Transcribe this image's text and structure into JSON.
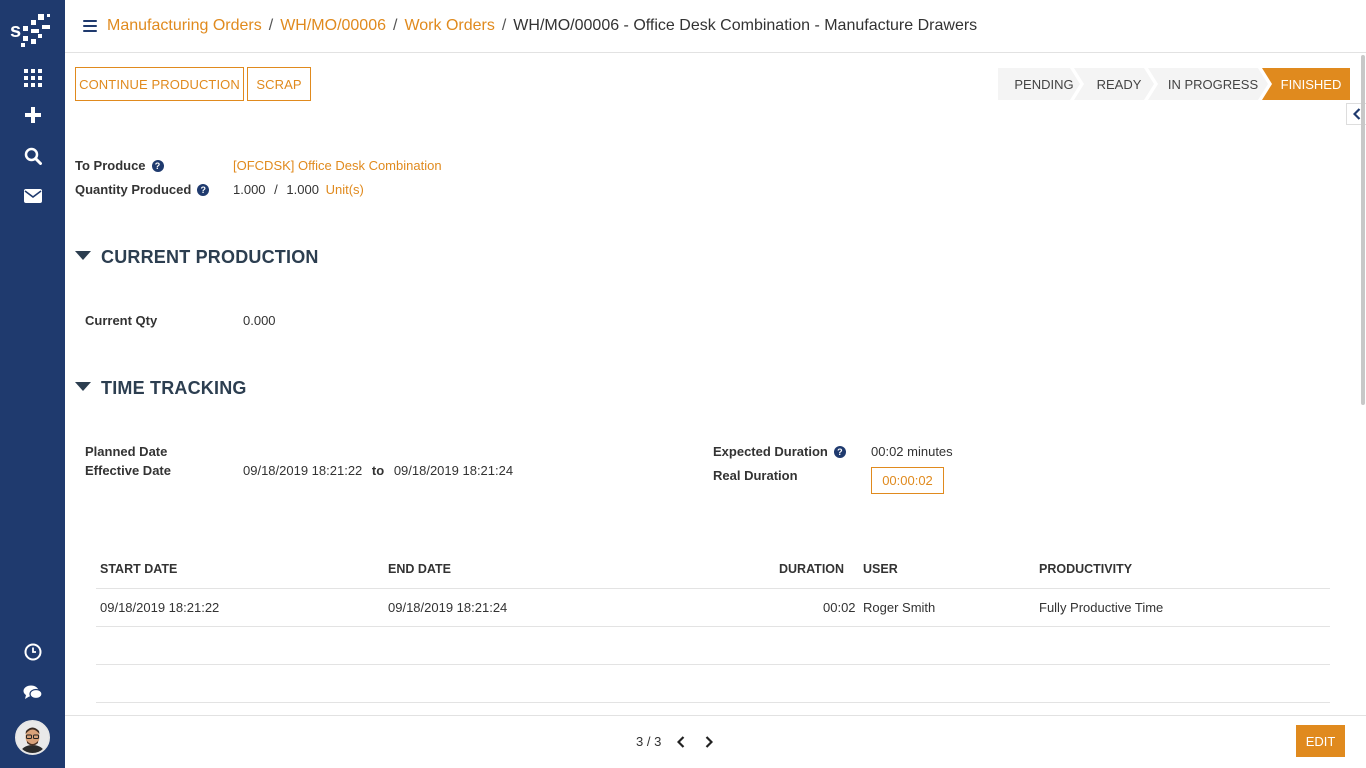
{
  "sidebar": {
    "icons": [
      "apps-grid-icon",
      "plus-icon",
      "search-icon",
      "mail-icon",
      "clock-icon",
      "chat-icon"
    ],
    "brand_color": "#1f3a6e"
  },
  "breadcrumb": {
    "items": [
      "Manufacturing Orders",
      "WH/MO/00006",
      "Work Orders"
    ],
    "current": "WH/MO/00006 - Office Desk Combination - Manufacture Drawers",
    "separator": "/"
  },
  "actions": {
    "continue_label": "CONTINUE PRODUCTION",
    "scrap_label": "SCRAP"
  },
  "status": {
    "stages": [
      "PENDING",
      "READY",
      "IN PROGRESS",
      "FINISHED"
    ],
    "active": "FINISHED",
    "accent_color": "#e08a1e"
  },
  "form": {
    "to_produce_label": "To Produce",
    "to_produce_value": "[OFCDSK] Office Desk Combination",
    "qty_produced_label": "Quantity Produced",
    "qty_produced": "1.000",
    "qty_sep": "/",
    "qty_total": "1.000",
    "uom": "Unit(s)"
  },
  "current_production": {
    "title": "CURRENT PRODUCTION",
    "current_qty_label": "Current Qty",
    "current_qty_value": "0.000"
  },
  "time_tracking": {
    "title": "TIME TRACKING",
    "planned_date_label": "Planned Date",
    "effective_date_label": "Effective Date",
    "effective_from": "09/18/2019 18:21:22",
    "to_word": "to",
    "effective_to": "09/18/2019 18:21:24",
    "expected_duration_label": "Expected Duration",
    "expected_duration_value": "00:02 minutes",
    "real_duration_label": "Real Duration",
    "real_duration_value": "00:00:02"
  },
  "table": {
    "columns": [
      "START DATE",
      "END DATE",
      "DURATION",
      "USER",
      "PRODUCTIVITY"
    ],
    "rows": [
      {
        "start": "09/18/2019 18:21:22",
        "end": "09/18/2019 18:21:24",
        "duration": "00:02",
        "user": "Roger Smith",
        "productivity": "Fully Productive Time"
      }
    ]
  },
  "pager": {
    "text": "3 / 3"
  },
  "footer": {
    "edit_label": "EDIT"
  }
}
